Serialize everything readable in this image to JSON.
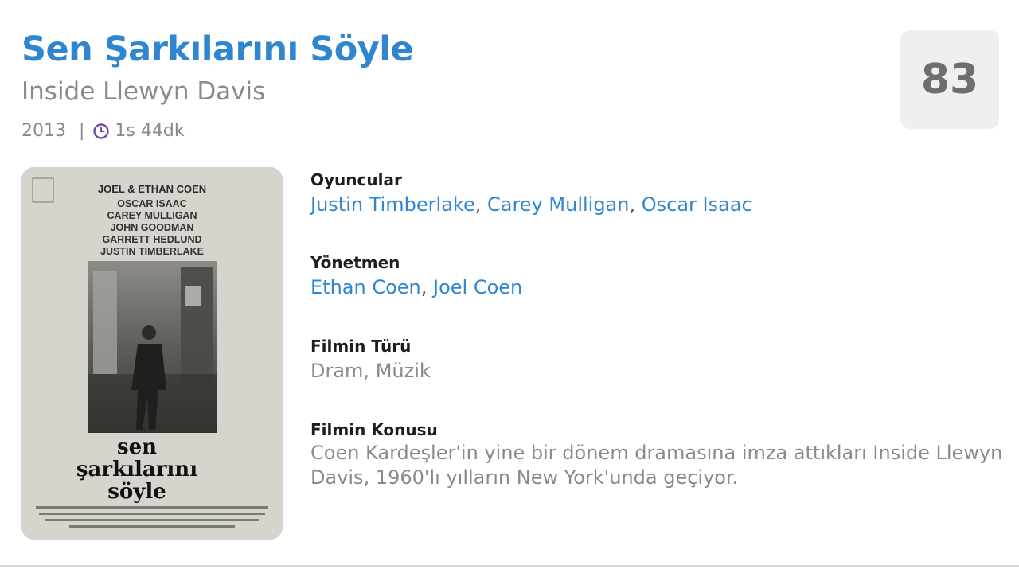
{
  "movie": {
    "title": "Sen Şarkılarını Söyle",
    "original_title": "Inside Llewyn Davis",
    "year": "2013",
    "separator": "|",
    "clock_icon": "clock-icon",
    "duration": "1s 44dk",
    "score": "83"
  },
  "details": {
    "cast_label": "Oyuncular",
    "cast": [
      "Justin Timberlake",
      "Carey Mulligan",
      "Oscar Isaac"
    ],
    "director_label": "Yönetmen",
    "directors": [
      "Ethan Coen",
      "Joel Coen"
    ],
    "genre_label": "Filmin Türü",
    "genre": "Dram, Müzik",
    "plot_label": "Filmin Konusu",
    "plot": "Coen Kardeşler'in yine bir dönem dramasına imza attıkları Inside Llewyn Davis, 1960'lı yılların New York'unda geçiyor."
  },
  "poster": {
    "credit_line": "JOEL & ETHAN COEN",
    "cast_lines": [
      "OSCAR ISAAC",
      "CAREY MULLIGAN",
      "JOHN GOODMAN",
      "GARRETT HEDLUND",
      "JUSTIN TIMBERLAKE"
    ],
    "title_lines": [
      "sen",
      "şarkılarını",
      "söyle"
    ]
  },
  "colors": {
    "accent": "#2f86cf",
    "muted": "#8a8a8a",
    "score_bg": "#efefef",
    "clock": "#6f4da0"
  }
}
